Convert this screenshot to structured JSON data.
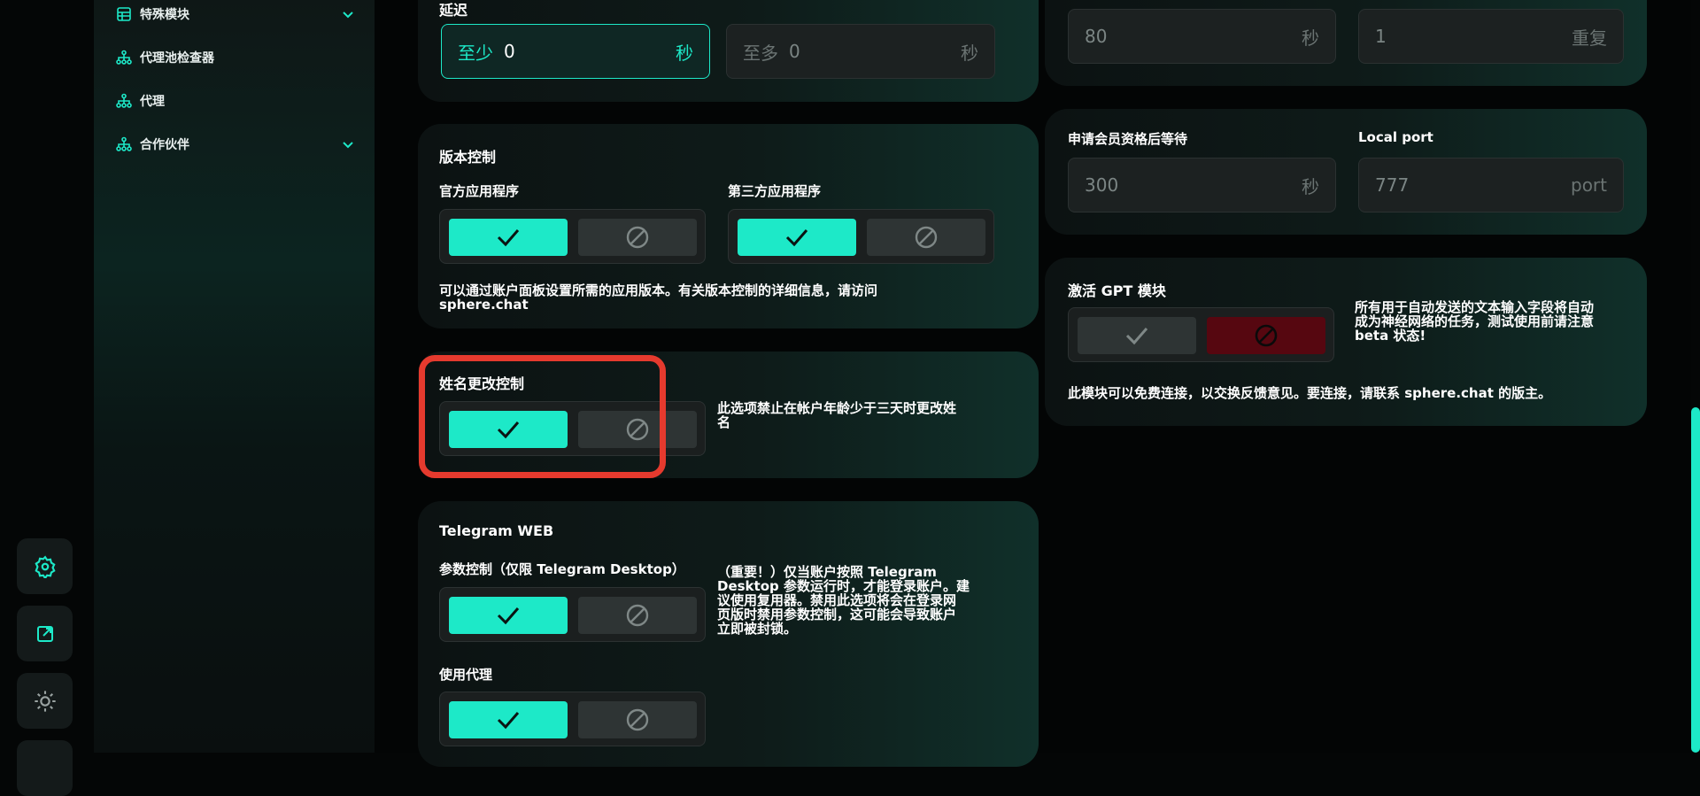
{
  "sidebar": {
    "items": [
      {
        "label": "特殊模块",
        "icon": "grid-icon",
        "expandable": true
      },
      {
        "label": "代理池检查器",
        "icon": "network-icon",
        "expandable": false
      },
      {
        "label": "代理",
        "icon": "network-icon",
        "expandable": false
      },
      {
        "label": "合作伙伴",
        "icon": "network-icon",
        "expandable": true
      }
    ]
  },
  "rail": {
    "buttons": [
      "settings-icon",
      "external-link-icon",
      "theme-icon"
    ]
  },
  "delay": {
    "title": "延迟",
    "min_prefix": "至少",
    "min_value": "0",
    "min_unit": "秒",
    "max_prefix": "至多",
    "max_value": "0",
    "max_unit": "秒"
  },
  "top_right": {
    "input1_value": "80",
    "input1_unit": "秒",
    "input2_value": "1",
    "input2_unit": "重复"
  },
  "version_control": {
    "title": "版本控制",
    "official_label": "官方应用程序",
    "third_party_label": "第三方应用程序",
    "note_line1": "可以通过账户面板设置所需的应用版本。有关版本控制的详细信息，请访问",
    "note_line2": "sphere.chat"
  },
  "membership": {
    "wait_label": "申请会员资格后等待",
    "wait_value": "300",
    "wait_unit": "秒",
    "port_label": "Local port",
    "port_value": "777",
    "port_unit": "port"
  },
  "name_change": {
    "title": "姓名更改控制",
    "note_line1": "此选项禁止在帐户年龄少于三天时更改姓",
    "note_line2": "名"
  },
  "gpt": {
    "title": "激活 GPT 模块",
    "side_line1": "所有用于自动发送的文本输入字段将自动",
    "side_line2": "成为神经网络的任务，测试使用前请注意",
    "side_line3": "beta 状态!",
    "note": "此模块可以免费连接，以交换反馈意见。要连接，请联系 sphere.chat 的版主。"
  },
  "telegram_web": {
    "title": "Telegram WEB",
    "param_label": "参数控制（仅限 Telegram Desktop）",
    "proxy_label": "使用代理",
    "note_line1": "（重要！）仅当账户按照 Telegram",
    "note_line2": "Desktop 参数运行时，才能登录账户。建",
    "note_line3": "议使用复用器。禁用此选项将会在登录网",
    "note_line4": "页版时禁用参数控制，这可能会导致账户",
    "note_line5": "立即被封锁。"
  },
  "colors": {
    "accent": "#1de9c8",
    "highlight": "#e53a2e",
    "danger_bg": "#560710"
  }
}
